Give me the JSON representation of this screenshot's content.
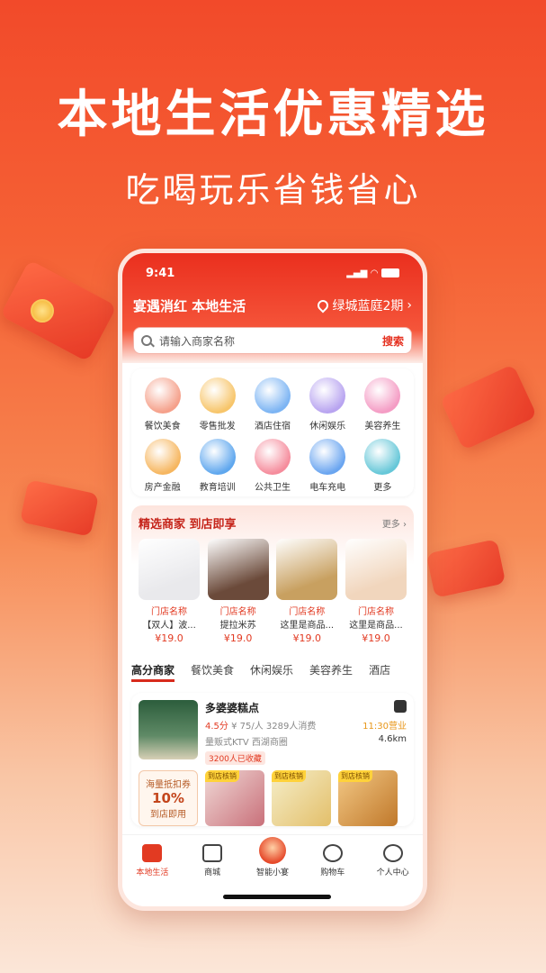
{
  "promo": {
    "headline": "本地生活优惠精选",
    "subline": "吃喝玩乐省钱省心"
  },
  "status": {
    "time": "9:41"
  },
  "header": {
    "title": "宴遇消红 本地生活",
    "location": "绿城蓝庭2期"
  },
  "search": {
    "placeholder": "请输入商家名称",
    "button": "搜索"
  },
  "categories": [
    {
      "label": "餐饮美食",
      "icon": "food-icon",
      "color": "#f5a08a"
    },
    {
      "label": "零售批发",
      "icon": "retail-icon",
      "color": "#f7c56a"
    },
    {
      "label": "酒店住宿",
      "icon": "hotel-icon",
      "color": "#7cb4f3"
    },
    {
      "label": "休闲娱乐",
      "icon": "leisure-icon",
      "color": "#b8a4f0"
    },
    {
      "label": "美容养生",
      "icon": "beauty-icon",
      "color": "#f49cc4"
    },
    {
      "label": "房产金融",
      "icon": "finance-icon",
      "color": "#f6b65f"
    },
    {
      "label": "教育培训",
      "icon": "education-icon",
      "color": "#5fa7ee"
    },
    {
      "label": "公共卫生",
      "icon": "health-icon",
      "color": "#f58c9c"
    },
    {
      "label": "电车充电",
      "icon": "charging-icon",
      "color": "#6aa5f0"
    },
    {
      "label": "更多",
      "icon": "more-icon",
      "color": "#66c7d8"
    }
  ],
  "featured": {
    "title": "精选商家 到店即享",
    "more": "更多 ›",
    "items": [
      {
        "name": "门店名称",
        "desc": "【双人】波...",
        "price": "¥19.0",
        "color": "#e9e9ec"
      },
      {
        "name": "门店名称",
        "desc": "提拉米苏",
        "price": "¥19.0",
        "color": "#6b4a3a"
      },
      {
        "name": "门店名称",
        "desc": "这里是商品...",
        "price": "¥19.0",
        "color": "#c8a060"
      },
      {
        "name": "门店名称",
        "desc": "这里是商品...",
        "price": "¥19.0",
        "color": "#f1d6bd"
      }
    ]
  },
  "tabs": [
    "高分商家",
    "餐饮美食",
    "休闲娱乐",
    "美容养生",
    "酒店"
  ],
  "shop": {
    "name": "多婆婆糕点",
    "rating": "4.5分",
    "per_person": "¥ 75/人",
    "consumption": "3289人消费",
    "hours": "11:30营业",
    "category": "量贩式KTV",
    "area": "西湖商圈",
    "distance": "4.6km",
    "favorites": "3200人已收藏",
    "coupon": {
      "title": "海量抵扣券",
      "value": "10%",
      "note": "到店即用"
    },
    "deal_tag": "到店核销"
  },
  "nav": [
    {
      "label": "本地生活",
      "icon": "home-icon",
      "active": true
    },
    {
      "label": "商城",
      "icon": "store-icon"
    },
    {
      "label": "智能小宴",
      "icon": "mascot-icon"
    },
    {
      "label": "购物车",
      "icon": "cart-icon"
    },
    {
      "label": "个人中心",
      "icon": "profile-icon"
    }
  ]
}
